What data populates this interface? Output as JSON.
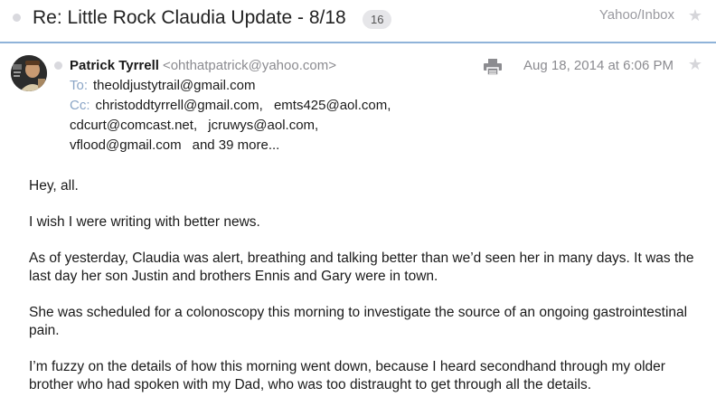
{
  "header": {
    "subject": "Re: Little Rock Claudia Update - 8/18",
    "thread_count": "16",
    "mailbox": "Yahoo/Inbox",
    "star_icon": "star-icon"
  },
  "message": {
    "sender_name": "Patrick Tyrrell",
    "sender_email": "<ohthatpatrick@yahoo.com>",
    "to_label": "To:",
    "to": [
      "theoldjustytrail@gmail.com"
    ],
    "cc_label": "Cc:",
    "cc_line1": [
      "christoddtyrrell@gmail.com,",
      "emts425@aol.com,"
    ],
    "cc_line2": [
      "cdcurt@comcast.net,",
      "jcruwys@aol.com,"
    ],
    "cc_line3": [
      "vflood@gmail.com"
    ],
    "more": "and 39 more...",
    "date": "Aug 18, 2014 at 6:06 PM",
    "print_icon": "printer-icon"
  },
  "body": [
    "Hey, all.",
    "I wish I were writing with better news.",
    "As of yesterday, Claudia was alert, breathing and talking better than we’d seen her in many days. It was the last day her son Justin and brothers Ennis and Gary were in town.",
    "She was scheduled for a colonoscopy this morning to investigate the source of an ongoing gastrointestinal pain.",
    "I’m fuzzy on the details of how this morning went down, because I heard secondhand through my older brother who had spoken with my Dad, who was too distraught to get through all the details."
  ],
  "colors": {
    "header_rule": "#8fb3d9",
    "label_blue": "#8aa5c6",
    "muted_gray": "#8b8b90"
  }
}
